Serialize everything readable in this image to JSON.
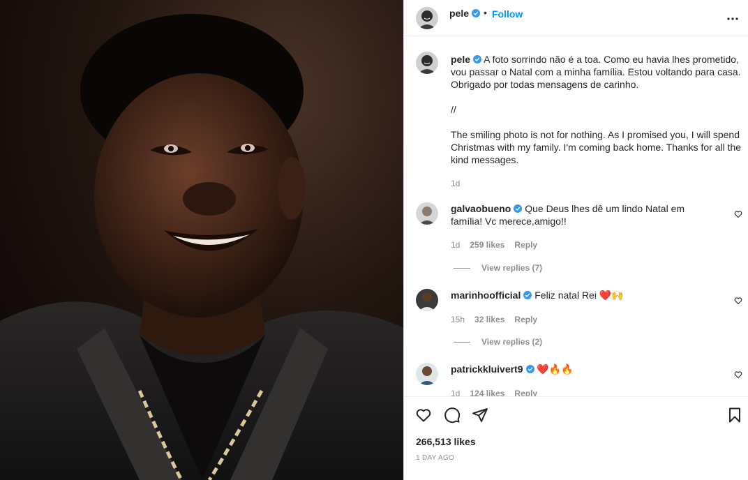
{
  "post": {
    "author": "pele",
    "follow_label": "Follow",
    "separator": "•",
    "caption": {
      "pt": "A foto sorrindo não é a toa. Como eu havia lhes prometido, vou passar o Natal com a minha família. Estou voltando para casa. Obrigado por todas mensagens de carinho.",
      "divider": "//",
      "en": "The smiling photo is not for nothing. As I promised you, I will spend Christmas with my family. I'm coming back home. Thanks for all the kind messages.",
      "time": "1d"
    },
    "likes": "266,513 likes",
    "posted_ago": "1 DAY AGO"
  },
  "comments": [
    {
      "user": "galvaobueno",
      "text": "Que Deus lhes dê um lindo Natal em família! Vc merece,amigo!!",
      "time": "1d",
      "likes": "259 likes",
      "reply": "Reply",
      "view_replies": "View replies (7)"
    },
    {
      "user": "marinhoofficial",
      "text": "Feliz natal Rei",
      "emoji": "❤️🙌",
      "time": "15h",
      "likes": "32 likes",
      "reply": "Reply",
      "view_replies": "View replies (2)"
    },
    {
      "user": "patrickkluivert9",
      "text": "",
      "emoji": "❤️🔥🔥",
      "time": "1d",
      "likes": "124 likes",
      "reply": "Reply"
    }
  ],
  "icons": {
    "like": "heart-icon",
    "comment": "comment-icon",
    "share": "share-icon",
    "save": "bookmark-icon",
    "more": "more-icon",
    "verified": "verified-badge-icon"
  },
  "colors": {
    "accent": "#0095f6",
    "verified": "#3897f0",
    "muted": "#8e8e8e"
  }
}
